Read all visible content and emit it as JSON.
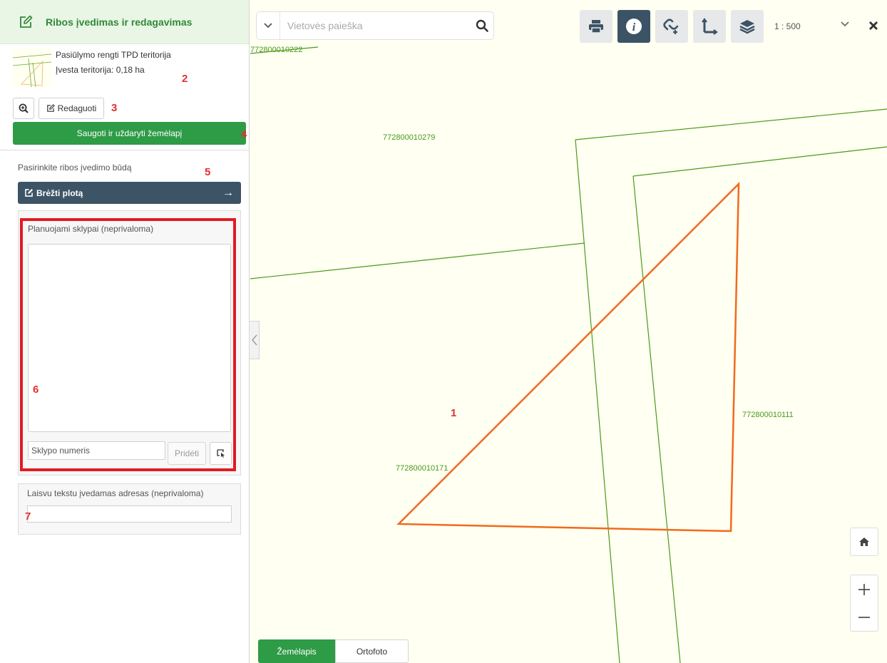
{
  "panel": {
    "title": "Ribos įvedimas ir redagavimas",
    "territory_name": "Pasiūlymo rengti TPD teritorija",
    "territory_area": "Įvesta teritorija: 0,18 ha",
    "edit_label": "Redaguoti",
    "save_label": "Saugoti ir uždaryti žemėlapį",
    "mode_label": "Pasirinkite ribos įvedimo būdą",
    "draw_label": "Brėžti plotą",
    "planned_plots_label": "Planuojami sklypai (neprivaloma)",
    "plot_number_placeholder": "Sklypo numeris",
    "plot_number_value": "",
    "add_label": "Pridėti",
    "address_label": "Laisvu tekstu įvedamas adresas (neprivaloma)",
    "address_value": ""
  },
  "annotations": [
    "1",
    "2",
    "3",
    "4",
    "5",
    "6",
    "7"
  ],
  "toolbar": {
    "search_placeholder": "Vietovės paieška",
    "scale": "1 : 500",
    "tools": [
      "print-icon",
      "info-icon",
      "link-add-icon",
      "measure-icon",
      "layers-icon"
    ],
    "active_tool": "info-icon"
  },
  "map": {
    "parcels": [
      "772800010222",
      "772800010279",
      "772800010111",
      "772800010171"
    ],
    "tabs": {
      "map": "Žemėlapis",
      "ortho": "Ortofoto"
    },
    "active_tab": "Žemėlapis"
  },
  "colors": {
    "accent_green": "#2e9b46",
    "dark_slate": "#3d5466",
    "highlight_red": "#e21a23",
    "parcel_line": "#4a9a1a",
    "drawn_area": "#f26a1b",
    "map_background": "#fffff2"
  }
}
